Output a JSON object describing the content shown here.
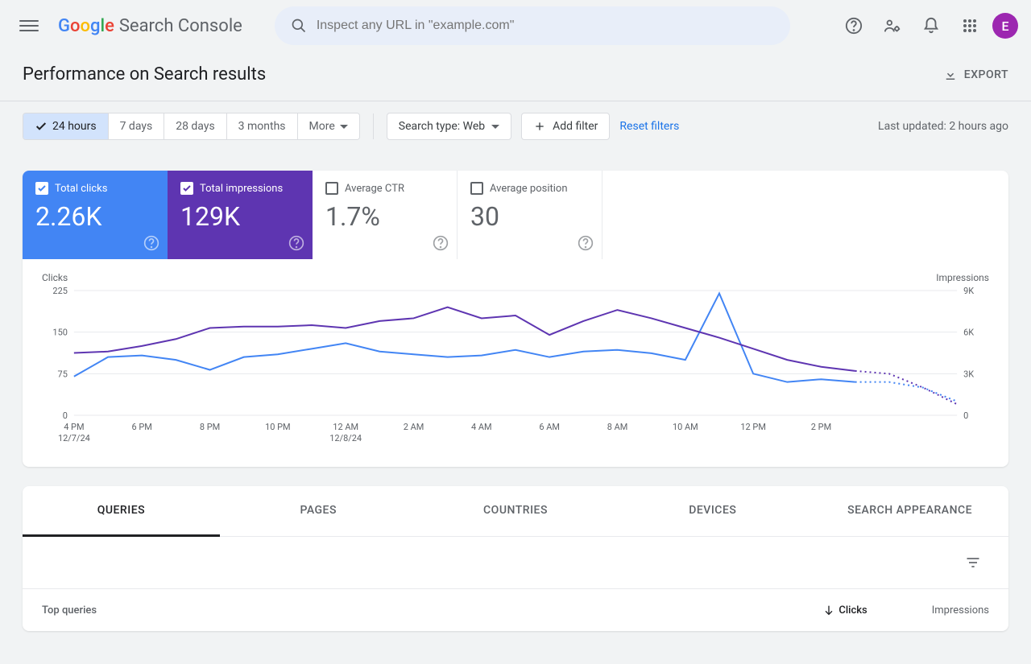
{
  "header": {
    "product_name": "Search Console",
    "search_placeholder": "Inspect any URL in \"example.com\"",
    "avatar_initial": "E"
  },
  "page": {
    "title": "Performance on Search results",
    "export_label": "EXPORT"
  },
  "filters": {
    "ranges": [
      "24 hours",
      "7 days",
      "28 days",
      "3 months",
      "More"
    ],
    "search_type": "Search type: Web",
    "add_filter": "Add filter",
    "reset": "Reset filters",
    "last_updated": "Last updated: 2 hours ago"
  },
  "metrics": {
    "clicks": {
      "label": "Total clicks",
      "value": "2.26K"
    },
    "impressions": {
      "label": "Total impressions",
      "value": "129K"
    },
    "ctr": {
      "label": "Average CTR",
      "value": "1.7%"
    },
    "position": {
      "label": "Average position",
      "value": "30"
    }
  },
  "chart_data": {
    "type": "line",
    "left_axis_label": "Clicks",
    "right_axis_label": "Impressions",
    "left_ticks": [
      0,
      75,
      150,
      225
    ],
    "right_ticks": [
      0,
      "3K",
      "6K",
      "9K"
    ],
    "x_labels": [
      "4 PM",
      "6 PM",
      "8 PM",
      "10 PM",
      "12 AM",
      "2 AM",
      "4 AM",
      "6 AM",
      "8 AM",
      "10 AM",
      "12 PM",
      "2 PM"
    ],
    "x_sublabels": {
      "0": "12/7/24",
      "4": "12/8/24"
    },
    "series": [
      {
        "name": "Clicks",
        "color": "#4285f4",
        "values": [
          70,
          105,
          108,
          100,
          82,
          105,
          110,
          120,
          130,
          115,
          110,
          105,
          108,
          118,
          105,
          115,
          118,
          112,
          100,
          220,
          75,
          60,
          65,
          60
        ],
        "dotted_tail": [
          60,
          50,
          25
        ]
      },
      {
        "name": "Impressions",
        "color": "#5e35b1",
        "values_k": [
          4.5,
          4.6,
          5.0,
          5.5,
          6.3,
          6.4,
          6.4,
          6.5,
          6.3,
          6.8,
          7.0,
          7.8,
          7.0,
          7.2,
          5.8,
          6.8,
          7.6,
          7.0,
          6.3,
          5.6,
          4.8,
          4.0,
          3.5,
          3.2
        ],
        "dotted_tail_k": [
          3.0,
          2.0,
          0.8
        ]
      }
    ]
  },
  "tabs": [
    "QUERIES",
    "PAGES",
    "COUNTRIES",
    "DEVICES",
    "SEARCH APPEARANCE"
  ],
  "table": {
    "header_left": "Top queries",
    "col_clicks": "Clicks",
    "col_impressions": "Impressions"
  }
}
